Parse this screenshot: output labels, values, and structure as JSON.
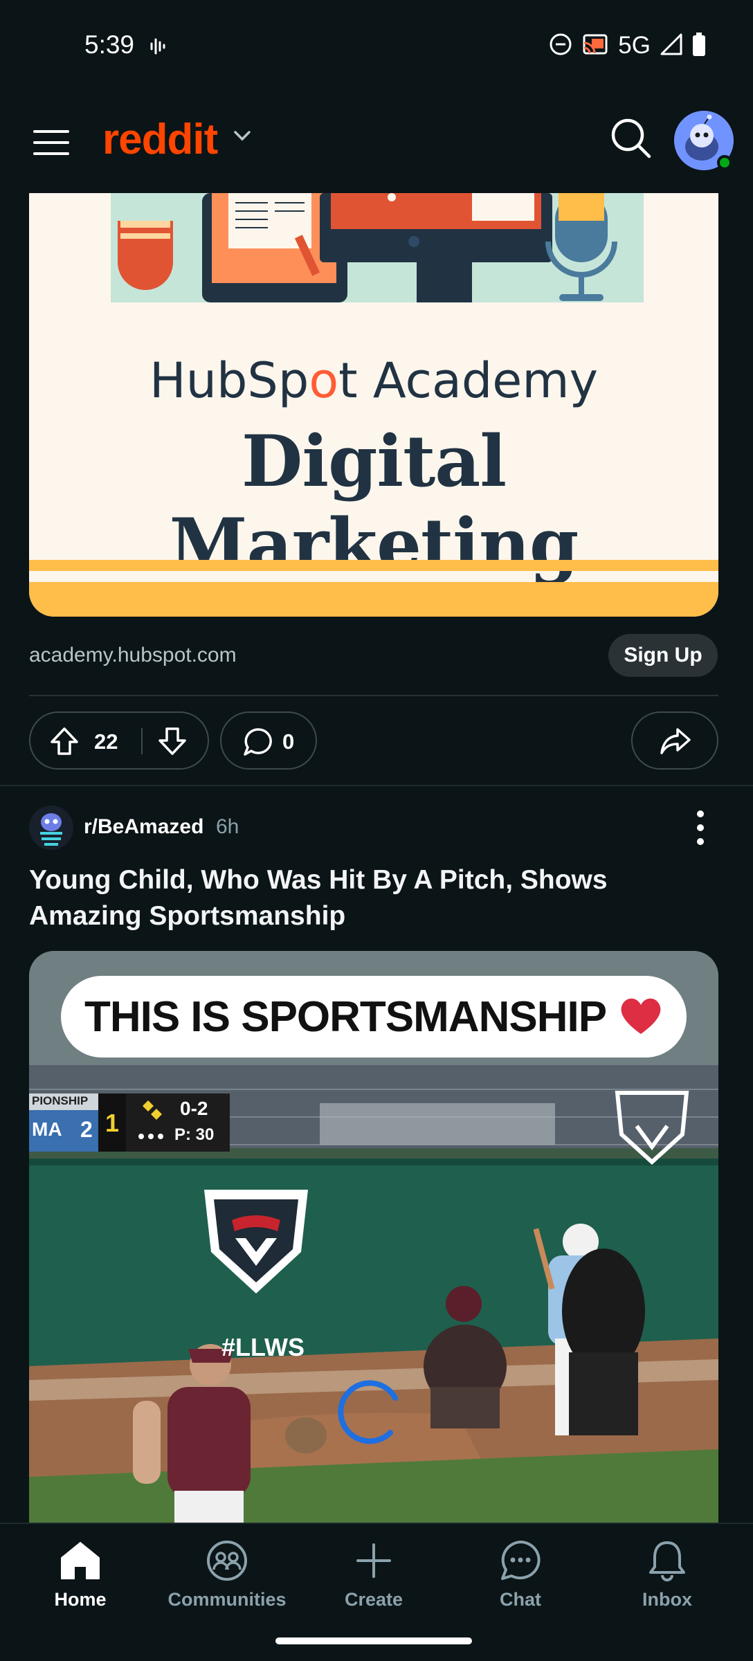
{
  "status_bar": {
    "time": "5:39",
    "network": "5G"
  },
  "header": {
    "logo": "reddit",
    "menu_icon": "hamburger-menu-icon",
    "search_icon": "search-icon",
    "avatar_icon": "snoo-avatar-icon",
    "accent_color": "#ff4500"
  },
  "ad_post": {
    "brand_prefix": "HubSp",
    "brand_mid": "o",
    "brand_suffix": "t Academy",
    "headline": "Digital Marketing",
    "domain": "academy.hubspot.com",
    "cta_label": "Sign Up",
    "vote_count": "22",
    "comment_count": "0"
  },
  "post": {
    "subreddit": "r/BeAmazed",
    "age": "6h",
    "title": "Young Child, Who Was Hit By A Pitch, Shows Amazing Sportsmanship",
    "video": {
      "caption": "THIS IS SPORTSMANSHIP",
      "caption_emoji": "❤️",
      "scoreboard_team": "MA",
      "scoreboard_score": "2",
      "scoreboard_label": "PIONSHIP",
      "scoreboard_count": "0-2",
      "scoreboard_pitches": "P: 30",
      "scoreboard_inning": "1",
      "wall_logo_text": "#LLWS",
      "loading": true
    }
  },
  "bottom_nav": {
    "items": [
      {
        "label": "Home",
        "icon": "home-icon",
        "active": true
      },
      {
        "label": "Communities",
        "icon": "communities-icon",
        "active": false
      },
      {
        "label": "Create",
        "icon": "plus-icon",
        "active": false
      },
      {
        "label": "Chat",
        "icon": "chat-icon",
        "active": false
      },
      {
        "label": "Inbox",
        "icon": "bell-icon",
        "active": false
      }
    ]
  }
}
